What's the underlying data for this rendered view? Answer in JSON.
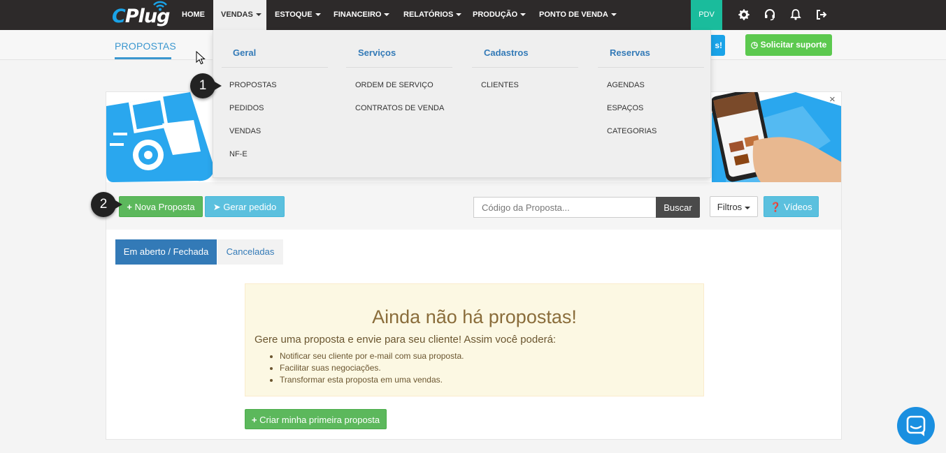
{
  "logo": {
    "c": "C",
    "rest": "Plug"
  },
  "nav": {
    "items": [
      {
        "label": "HOME",
        "dropdown": false
      },
      {
        "label": "VENDAS",
        "dropdown": true
      },
      {
        "label": "ESTOQUE",
        "dropdown": true
      },
      {
        "label": "FINANCEIRO",
        "dropdown": true
      },
      {
        "label": "RELATÓRIOS",
        "dropdown": true
      },
      {
        "label": "PRODUÇÃO",
        "dropdown": true
      },
      {
        "label": "PONTO DE VENDA",
        "dropdown": true
      }
    ],
    "pdv": "PDV",
    "icons": [
      "gear-icon",
      "headset-icon",
      "bell-icon",
      "logout-icon"
    ]
  },
  "subbar": {
    "title": "PROPOSTAS",
    "partial_button": "s!",
    "support_button": "Solicitar suporte"
  },
  "dropdown": {
    "columns": [
      {
        "header": "Geral",
        "items": [
          "PROPOSTAS",
          "PEDIDOS",
          "VENDAS",
          "NF-E"
        ]
      },
      {
        "header": "Serviços",
        "items": [
          "ORDEM DE SERVIÇO",
          "CONTRATOS DE VENDA"
        ]
      },
      {
        "header": "Cadastros",
        "items": [
          "CLIENTES"
        ]
      },
      {
        "header": "Reservas",
        "items": [
          "AGENDAS",
          "ESPAÇOS",
          "CATEGORIAS"
        ]
      }
    ]
  },
  "banner": {
    "close": "×"
  },
  "toolbar": {
    "new_label": "Nova Proposta",
    "order_label": "Gerar pedido",
    "search_placeholder": "Código da Proposta...",
    "search_button": "Buscar",
    "filters_label": "Filtros",
    "videos_label": "Vídeos"
  },
  "tabs": [
    "Em aberto / Fechada",
    "Canceladas"
  ],
  "empty": {
    "title": "Ainda não há propostas!",
    "description": "Gere uma proposta e envie para seu cliente! Assim você poderá:",
    "bullets": [
      "Notificar seu cliente por e-mail com sua proposta.",
      "Facilitar suas negociações.",
      "Transformar esta proposta em uma vendas."
    ],
    "create_label": "Criar minha primeira proposta"
  },
  "callouts": [
    "1",
    "2"
  ],
  "colors": {
    "nav_bg": "#2d2a2a",
    "accent_blue": "#337ab7",
    "primary_green": "#5cb85c",
    "info": "#5bc0de",
    "pdv": "#1abc9c",
    "warning_bg": "#fcf8e3"
  }
}
